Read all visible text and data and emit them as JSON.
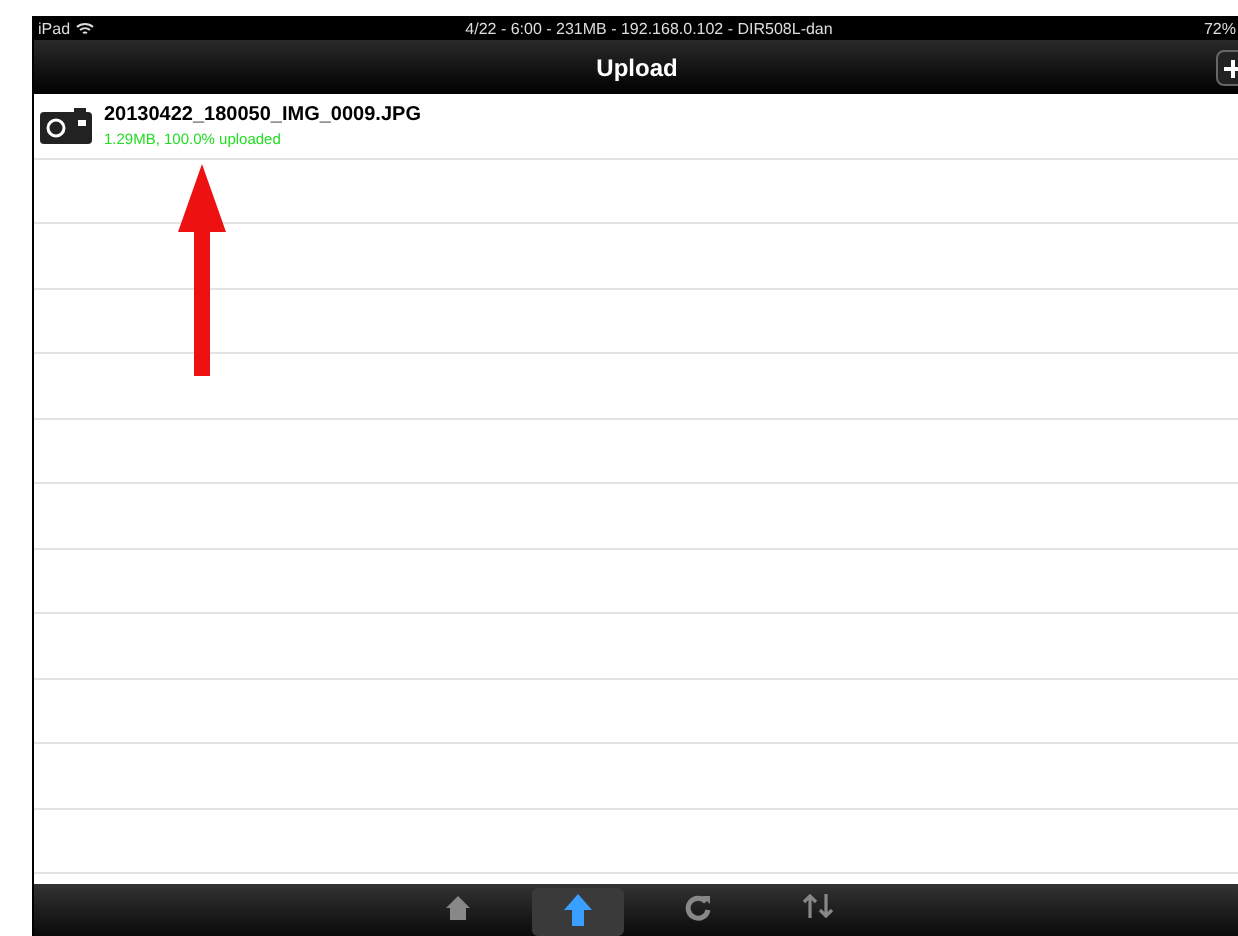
{
  "status_bar": {
    "device": "iPad",
    "center": "4/22 - 6:00 - 231MB - 192.168.0.102 - DIR508L-dan",
    "battery": "72%"
  },
  "nav_bar": {
    "title": "Upload"
  },
  "files": [
    {
      "name": "20130422_180050_IMG_0009.JPG",
      "status": "1.29MB, 100.0% uploaded"
    }
  ],
  "tabs": [
    {
      "kind": "home",
      "selected": false
    },
    {
      "kind": "upload",
      "selected": true
    },
    {
      "kind": "refresh",
      "selected": false
    },
    {
      "kind": "sort",
      "selected": false
    }
  ]
}
